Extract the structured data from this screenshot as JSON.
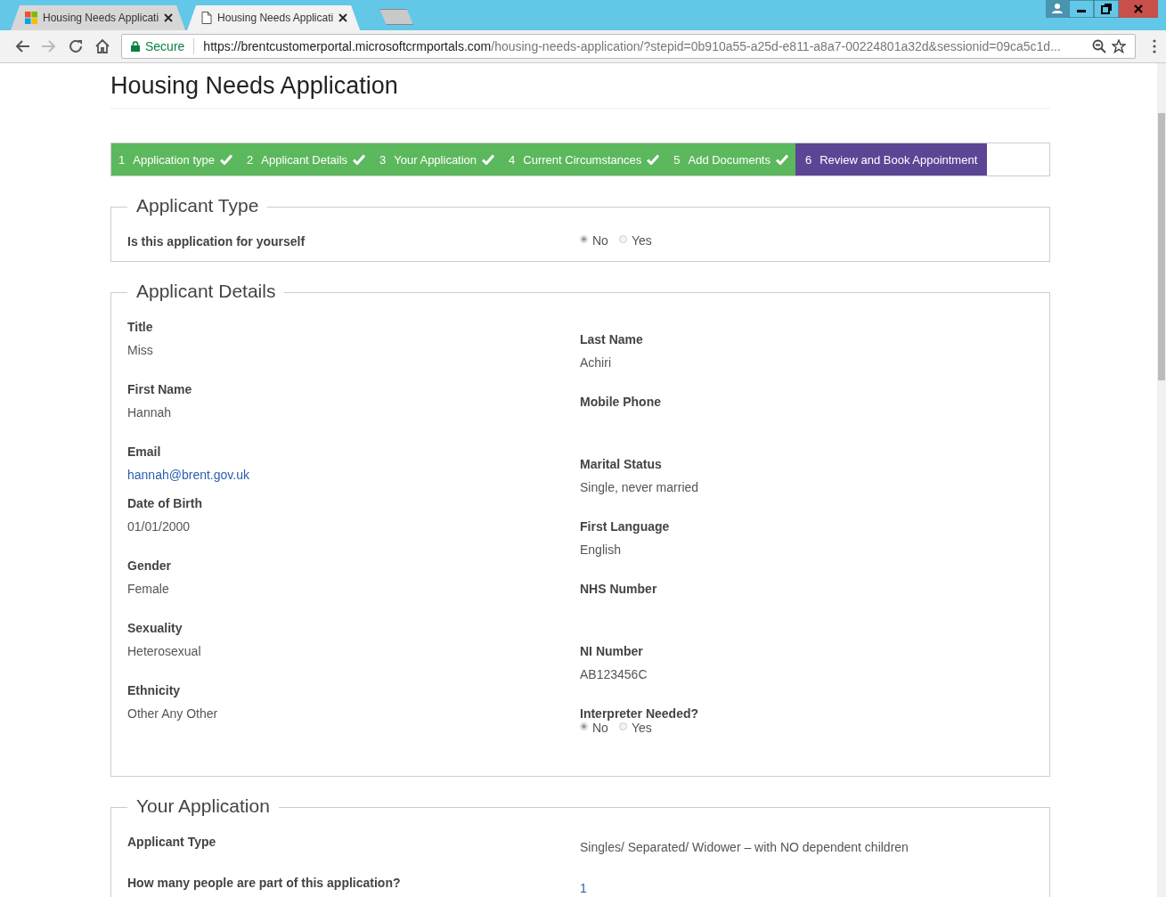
{
  "browser": {
    "tabs": [
      {
        "title": "Housing Needs Applicati",
        "selected": false
      },
      {
        "title": "Housing Needs Applicati",
        "selected": true
      }
    ],
    "address": {
      "secure": "Secure",
      "host": "https://brentcustomerportal.microsoftcrmportals.com",
      "path": "/housing-needs-application/?stepid=0b910a55-a25d-e811-a8a7-00224801a32d&sessionid=09ca5c1d..."
    }
  },
  "page": {
    "title": "Housing Needs Application",
    "steps": [
      {
        "number": "1",
        "label": "Application type",
        "completed": true,
        "selected": false
      },
      {
        "number": "2",
        "label": "Applicant Details",
        "completed": true,
        "selected": false
      },
      {
        "number": "3",
        "label": "Your Application",
        "completed": true,
        "selected": false
      },
      {
        "number": "4",
        "label": "Current Circumstances",
        "completed": true,
        "selected": false
      },
      {
        "number": "5",
        "label": "Add Documents",
        "completed": true,
        "selected": false
      },
      {
        "number": "6",
        "label": "Review and Book Appointment",
        "completed": false,
        "selected": true
      }
    ],
    "sections": [
      {
        "kind": "rows",
        "title": "Applicant Type",
        "rows": [
          {
            "label": "Is this application for yourself",
            "kind": "radio",
            "options": [
              {
                "label": "No",
                "selected": true
              },
              {
                "label": "Yes",
                "selected": false
              }
            ]
          }
        ]
      },
      {
        "kind": "columns",
        "title": "Applicant Details",
        "columns": [
          [
            {
              "label": "Title",
              "value": "Miss"
            },
            {
              "label": "First Name",
              "value": "Hannah"
            },
            {
              "label": "Email",
              "value": "hannah@brent.gov.uk",
              "kind": "link"
            },
            {
              "label": "Date of Birth",
              "value": "01/01/2000"
            },
            {
              "label": "Gender",
              "value": "Female"
            },
            {
              "label": "Sexuality",
              "value": "Heterosexual"
            },
            {
              "label": "Ethnicity",
              "value": "Other Any Other"
            }
          ],
          [
            {
              "label": "Last Name",
              "value": "Achiri"
            },
            {
              "label": "Mobile Phone"
            },
            {
              "label": "Marital Status",
              "value": "Single, never married"
            },
            {
              "label": "First Language",
              "value": "English"
            },
            {
              "label": "NHS Number"
            },
            {
              "label": "NI Number",
              "value": "AB123456C"
            },
            {
              "label": "Interpreter Needed?",
              "kind": "radio",
              "options": [
                {
                  "label": "No",
                  "selected": true
                },
                {
                  "label": "Yes",
                  "selected": false
                }
              ]
            }
          ]
        ]
      },
      {
        "kind": "rows",
        "title": "Your Application",
        "rows": [
          {
            "label": "Applicant Type",
            "value": "Singles/ Separated/ Widower – with NO dependent children"
          },
          {
            "label": "How many people are part of this application?",
            "value": "1",
            "kind": "link"
          }
        ]
      }
    ]
  }
}
